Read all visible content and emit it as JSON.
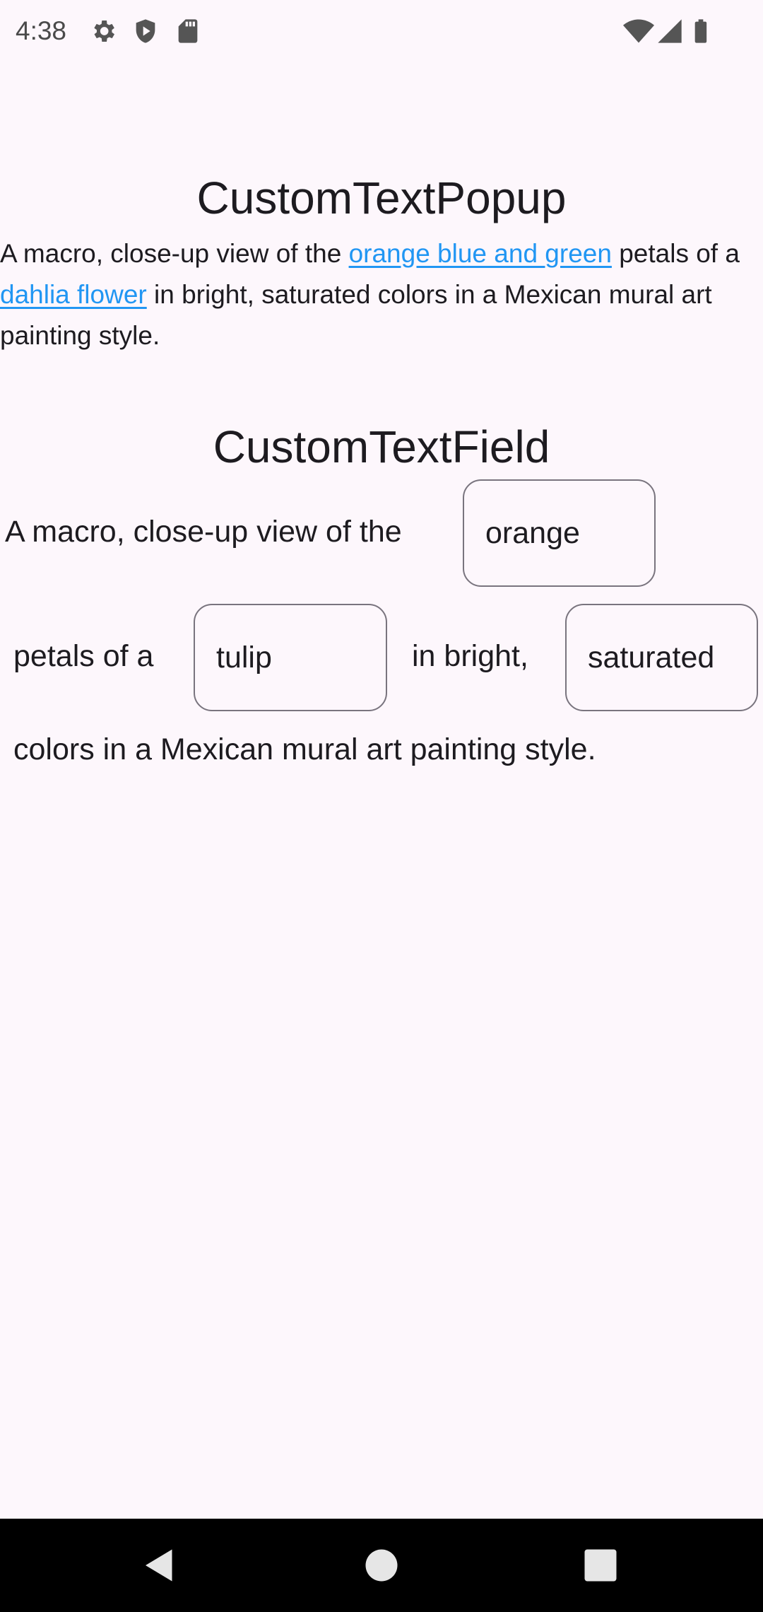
{
  "status_bar": {
    "time": "4:38",
    "icons": [
      "gear-icon",
      "shield-icon",
      "sd-card-icon",
      "wifi-icon",
      "signal-icon",
      "battery-icon"
    ]
  },
  "popup_section": {
    "title": "CustomTextPopup",
    "text_1": "A macro, close-up view of the ",
    "link_1": "orange blue and green",
    "text_2": " petals of a ",
    "link_2": "dahlia flower",
    "text_3": " in bright, saturated colors in a Mexican mural art painting style."
  },
  "field_section": {
    "title": "CustomTextField",
    "text_1": "A macro, close-up view of the",
    "field_1_value": "orange",
    "text_2": "petals of a",
    "field_2_value": "tulip",
    "text_3": "in bright,",
    "field_3_value": "saturated",
    "text_4": "colors in a Mexican mural art painting style."
  },
  "navigation": {
    "icons": [
      "back-icon",
      "home-icon",
      "recents-icon"
    ]
  },
  "colors": {
    "background": "#fdf7fc",
    "link": "#2196f3",
    "text": "#1d1b20",
    "field_border": "#79747e"
  }
}
